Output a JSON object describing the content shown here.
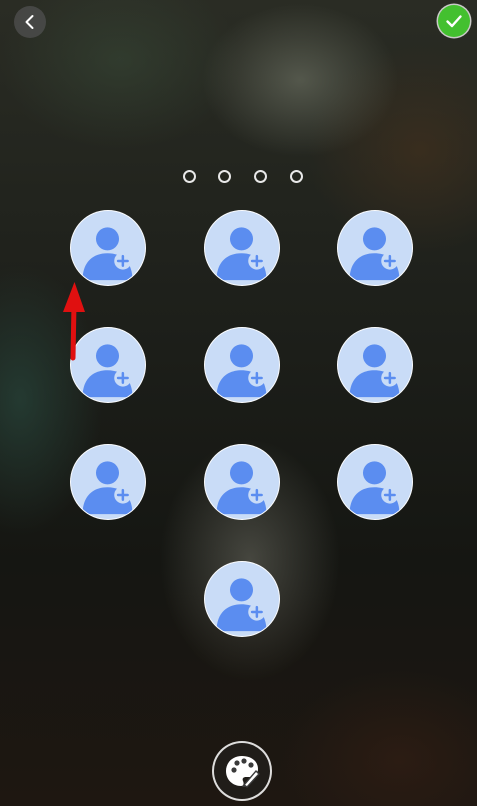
{
  "header": {
    "back_icon": "chevron-left-icon",
    "confirm_icon": "checkmark-icon",
    "confirm_color": "#43c02f"
  },
  "passcode": {
    "length": 4,
    "entered": 0
  },
  "keypad": {
    "key_icon": "add-contact-icon",
    "key_count": 10,
    "key_fill": "#c9dcf7",
    "avatar_color": "#5b8df0"
  },
  "annotation": {
    "icon": "red-arrow-icon",
    "color": "#e01010"
  },
  "footer": {
    "theme_icon": "palette-brush-icon"
  }
}
